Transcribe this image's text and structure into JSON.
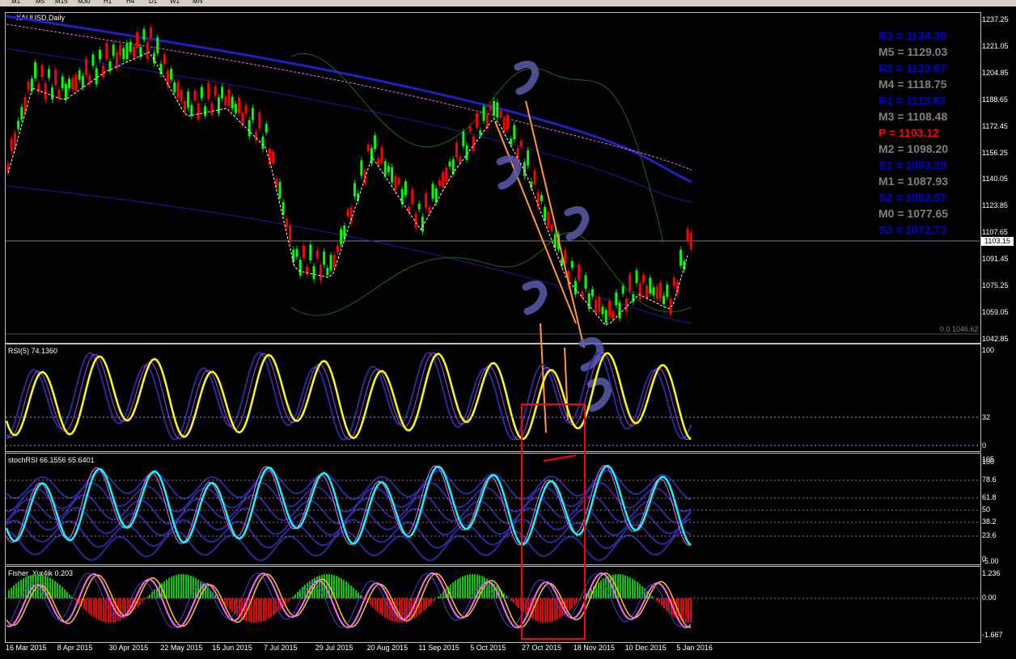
{
  "timeframes": [
    "M1",
    "M5",
    "M15",
    "M30",
    "H1",
    "H4",
    "D1",
    "W1",
    "MN"
  ],
  "chart_title": "XAUUSD,Daily",
  "price_ticks": [
    "1237.25",
    "1221.05",
    "1204.85",
    "1188.65",
    "1172.45",
    "1156.25",
    "1140.05",
    "1123.85",
    "1107.65",
    "1091.45",
    "1075.25",
    "1059.05",
    "1042.85"
  ],
  "current_price": "1103.15",
  "fib_label": "0.0 1046.62",
  "pivots": [
    {
      "label": "R3 = 1134.38",
      "color": "#0000cc"
    },
    {
      "label": "M5 = 1129.03",
      "color": "#808080"
    },
    {
      "label": "R2 = 1123.67",
      "color": "#0000cc"
    },
    {
      "label": "M4 = 1118.75",
      "color": "#808080"
    },
    {
      "label": "R1 = 1113.83",
      "color": "#0000cc"
    },
    {
      "label": "M3 = 1108.48",
      "color": "#808080"
    },
    {
      "label": "P   = 1103.12",
      "color": "#ff0000"
    },
    {
      "label": "M2 = 1098.20",
      "color": "#808080"
    },
    {
      "label": "S1 = 1093.29",
      "color": "#0000cc"
    },
    {
      "label": "M1 = 1087.93",
      "color": "#808080"
    },
    {
      "label": "S2 = 1082.57",
      "color": "#0000cc"
    },
    {
      "label": "M0 = 1077.65",
      "color": "#808080"
    },
    {
      "label": "S3 = 1072.73",
      "color": "#0000cc"
    }
  ],
  "rsi": {
    "label": "RSI(5) 74.1360",
    "ticks": [
      "100",
      "32",
      "0"
    ]
  },
  "stochrsi": {
    "label": "stochRSI 66.1556 65.6401",
    "ticks": [
      "105",
      "100",
      "78.6",
      "61.8",
      "50",
      "38.2",
      "23.6",
      "0",
      "-5.00"
    ]
  },
  "fisher": {
    "label": "Fisher_Yur4ik 0.203",
    "ticks": [
      "1.236",
      "0.00",
      "-1.667"
    ]
  },
  "dates": [
    "16 Mar 2015",
    "8 Apr 2015",
    "30 Apr 2015",
    "22 May 2015",
    "15 Jun 2015",
    "7 Jul 2015",
    "29 Jul 2015",
    "20 Aug 2015",
    "11 Sep 2015",
    "5 Oct 2015",
    "27 Oct 2015",
    "18 Nov 2015",
    "10 Dec 2015",
    "5 Jan 2016"
  ],
  "colors": {
    "bull": "#00ff00",
    "bear": "#ff0000",
    "rsi": "#ffff00",
    "stoch": "#00ffff",
    "bands": "#1a1aa8",
    "annotation": "#5a5aaa"
  }
}
